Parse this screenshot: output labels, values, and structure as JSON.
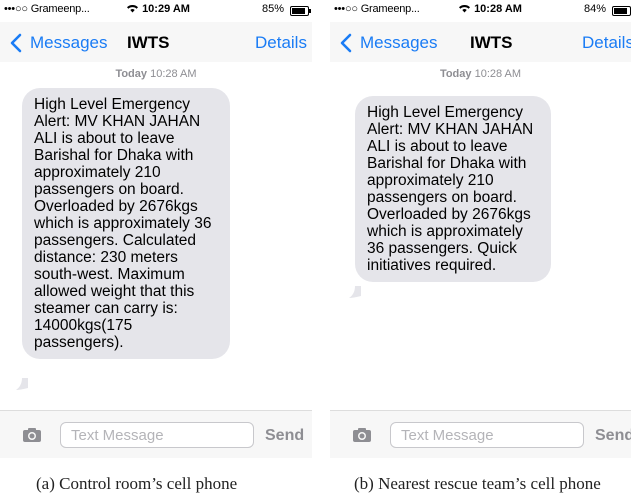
{
  "phones": [
    {
      "carrier": "•••○○ Grameenp...",
      "time": "10:29 AM",
      "battery": "85%",
      "battery_level": 0.85,
      "back_label": "Messages",
      "title": "IWTS",
      "details_label": "Details",
      "date_day": "Today",
      "date_time": "10:28 AM",
      "message": "High Level Emergency Alert: MV KHAN JAHAN ALI is about to leave Barishal for Dhaka with approximately 210 passengers on board. Overloaded by 2676kgs which is approximately 36 passengers. Calculated distance: 230 meters south-west. Maximum allowed weight that this steamer can carry is: 14000kgs(175 passengers).",
      "input_placeholder": "Text Message",
      "send_label": "Send",
      "caption": "(a) Control room’s cell phone"
    },
    {
      "carrier": "•••○○ Grameenp...",
      "time": "10:28 AM",
      "battery": "84%",
      "battery_level": 0.84,
      "back_label": "Messages",
      "title": "IWTS",
      "details_label": "Details",
      "date_day": "Today",
      "date_time": "10:28 AM",
      "message": "High Level Emergency Alert: MV KHAN JAHAN ALI is about to leave Barishal for Dhaka with approximately 210 passengers on board. Overloaded by 2676kgs which is approximately 36 passengers. Quick initiatives required.",
      "input_placeholder": "Text Message",
      "send_label": "Send",
      "caption": "(b) Nearest rescue team’s cell phone"
    }
  ],
  "colors": {
    "accent": "#1a7cf5",
    "bubble": "#e5e5ea",
    "bar": "#f7f7f7"
  }
}
